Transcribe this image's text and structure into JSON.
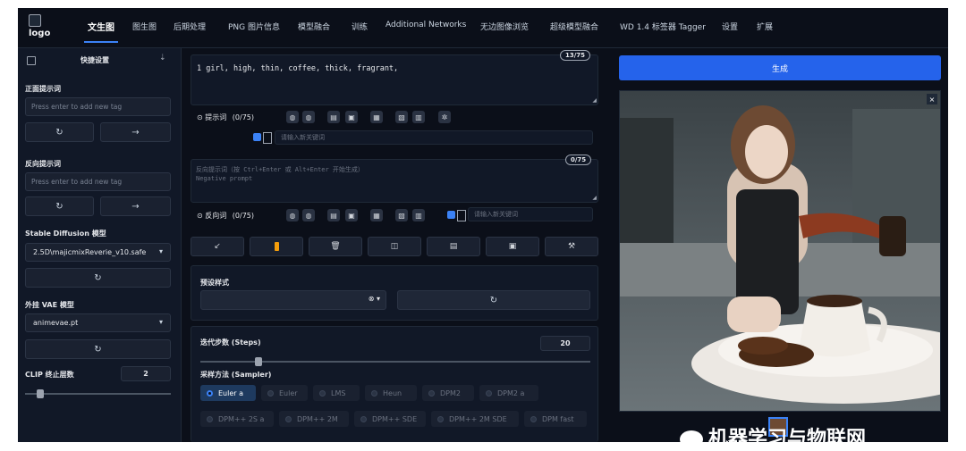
{
  "app": {
    "logo_text": "logo"
  },
  "tabs": [
    "文生图",
    "图生图",
    "后期处理",
    "PNG 图片信息",
    "模型融合",
    "训练",
    "Additional Networks",
    "无边图像浏览",
    "超级模型融合",
    "WD 1.4 标签器 Tagger",
    "设置",
    "扩展"
  ],
  "active_tab": "文生图",
  "sidebar": {
    "title": "快捷设置",
    "positive_label": "正面提示词",
    "positive_placeholder": "Press enter to add new tag",
    "negative_label": "反向提示词",
    "negative_placeholder": "Press enter to add new tag",
    "model_label": "Stable Diffusion 模型",
    "model_value": "2.5D\\majicmixReverie_v10.safe",
    "vae_label": "外挂 VAE 模型",
    "vae_value": "animevae.pt",
    "clip_label": "CLIP 终止层数",
    "clip_value": "2",
    "clip_slider_fraction": 0.08
  },
  "prompt": {
    "text": "1 girl, high, thin, coffee, thick, fragrant,",
    "counter": "13/75",
    "tag_label": "提示词",
    "tag_count": "(0/75)",
    "new_keyword_placeholder": "请输入新关键词"
  },
  "negative_prompt": {
    "placeholder_line1": "反向提示词（按 Ctrl+Enter 或 Alt+Enter 开始生成）",
    "placeholder_line2": "Negative prompt",
    "counter": "0/75",
    "tag_label": "反向词",
    "tag_count": "(0/75)",
    "new_keyword_placeholder": "请输入新关键词"
  },
  "styles": {
    "label": "预设样式"
  },
  "steps": {
    "label": "迭代步数 (Steps)",
    "value": "20",
    "slider_fraction": 0.14
  },
  "sampler": {
    "label": "采样方法 (Sampler)",
    "selected": "Euler a",
    "row1": [
      "Euler a",
      "Euler",
      "LMS",
      "Heun",
      "DPM2",
      "DPM2 a"
    ],
    "row2": [
      "DPM++ 2S a",
      "DPM++ 2M",
      "DPM++ SDE",
      "DPM++ 2M SDE",
      "DPM fast"
    ]
  },
  "generate_label": "生成",
  "watermark": "机器学习与物联网",
  "colors": {
    "accent": "#2563eb",
    "bg": "#0b0f19",
    "panel": "#111827"
  }
}
